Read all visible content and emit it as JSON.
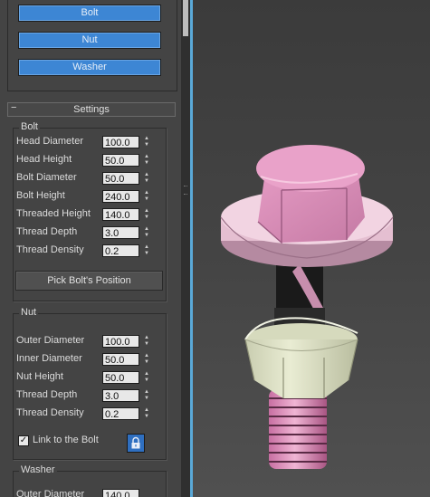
{
  "objects": {
    "bolt_label": "Bolt",
    "nut_label": "Nut",
    "washer_label": "Washer"
  },
  "settings": {
    "rollout_toggle": "−",
    "title": "Settings",
    "bolt": {
      "group_title": "Bolt",
      "fields": [
        {
          "label": "Head Diameter",
          "value": "100.0"
        },
        {
          "label": "Head Height",
          "value": "50.0"
        },
        {
          "label": "Bolt Diameter",
          "value": "50.0"
        },
        {
          "label": "Bolt Height",
          "value": "240.0"
        },
        {
          "label": "Threaded Height",
          "value": "140.0"
        },
        {
          "label": "Thread Depth",
          "value": "3.0"
        },
        {
          "label": "Thread Density",
          "value": "0.2"
        }
      ],
      "pick_button": "Pick Bolt's Position"
    },
    "nut": {
      "group_title": "Nut",
      "fields": [
        {
          "label": "Outer Diameter",
          "value": "100.0"
        },
        {
          "label": "Inner Diameter",
          "value": "50.0"
        },
        {
          "label": "Nut Height",
          "value": "50.0"
        },
        {
          "label": "Thread Depth",
          "value": "3.0"
        },
        {
          "label": "Thread Density",
          "value": "0.2"
        }
      ],
      "link_label": "Link to the Bolt",
      "link_checked": true
    },
    "washer": {
      "group_title": "Washer",
      "fields": [
        {
          "label": "Outer Diameter",
          "value": "140.0"
        }
      ]
    }
  },
  "icons": {
    "spinner_up": "▲",
    "spinner_down": "▼",
    "lock": "lock-icon",
    "check": "✓"
  },
  "colors": {
    "accent_blue": "#3d86d4",
    "divider_blue": "#5aa9d8",
    "bolt_pink": "#d98bb8",
    "washer_pink": "#e8c4d6",
    "nut_cream": "#dfe3c7"
  }
}
